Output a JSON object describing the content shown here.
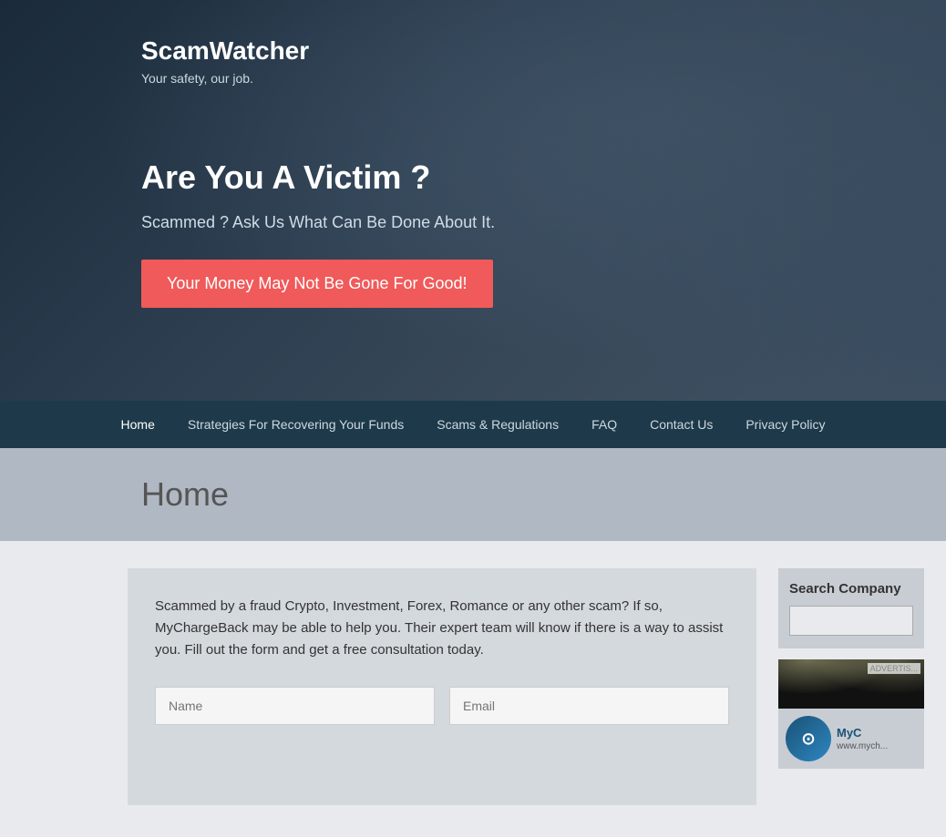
{
  "site": {
    "title": "ScamWatcher",
    "tagline": "Your safety, our job."
  },
  "hero": {
    "heading": "Are You A Victim ?",
    "subheading": "Scammed ? Ask Us What Can Be Done About It.",
    "cta_label": "Your Money May Not Be Gone For Good!"
  },
  "navbar": {
    "items": [
      {
        "label": "Home",
        "active": true
      },
      {
        "label": "Strategies For Recovering Your Funds",
        "active": false
      },
      {
        "label": "Scams & Regulations",
        "active": false
      },
      {
        "label": "FAQ",
        "active": false
      },
      {
        "label": "Contact Us",
        "active": false
      },
      {
        "label": "Privacy Policy",
        "active": false
      }
    ]
  },
  "page_title": "Home",
  "main": {
    "content_text": "Scammed by a fraud Crypto, Investment, Forex, Romance or any other scam? If so, MyChargeBack may be able to help you. Their expert team will know if there is a way to assist you. Fill out the form and get a free consultation today.",
    "form": {
      "name_placeholder": "Name",
      "email_placeholder": "Email"
    }
  },
  "sidebar": {
    "search_title": "Search Company",
    "search_placeholder": "",
    "ad_label": "ADVERTIS...",
    "ad_brand": "MyC",
    "ad_url": "www.mych..."
  }
}
